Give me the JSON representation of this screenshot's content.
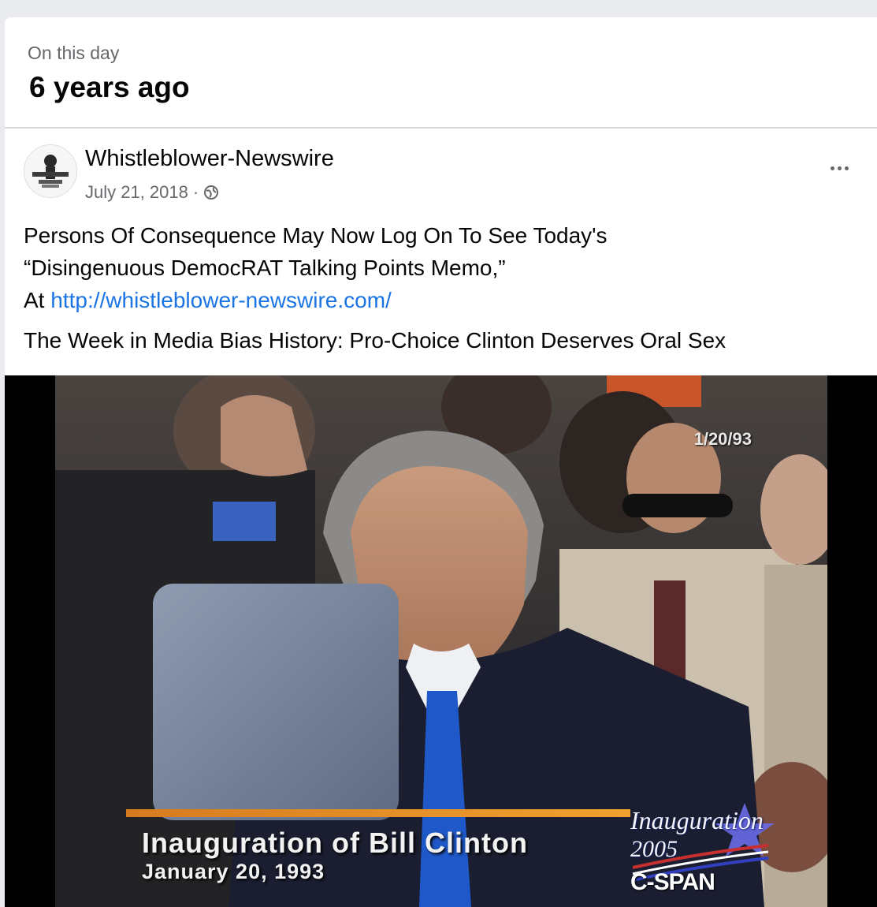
{
  "memory": {
    "subtitle": "On this day",
    "title": "6 years ago"
  },
  "post": {
    "author": "Whistleblower-Newswire",
    "date": "July 21, 2018",
    "separator": "·",
    "privacy_icon": "globe-icon",
    "more_icon": "more-options-icon",
    "text_line1": "Persons Of Consequence May Now Log On To See Today's",
    "text_line2": "“Disingenuous DemocRAT Talking Points Memo,”",
    "text_line3_prefix": "At ",
    "link": "http://whistleblower-newswire.com/",
    "headline": "The Week in Media Bias History: Pro-Choice Clinton Deserves Oral Sex"
  },
  "video": {
    "date_stamp": "1/20/93",
    "caption_title": "Inauguration of Bill Clinton",
    "caption_date": "January 20, 1993",
    "logo_title": "Inauguration",
    "logo_year": "2005",
    "logo_network": "C-SPAN"
  },
  "colors": {
    "link": "#1b74e4",
    "secondary_text": "#65676b",
    "tie": "#1f58c8"
  }
}
